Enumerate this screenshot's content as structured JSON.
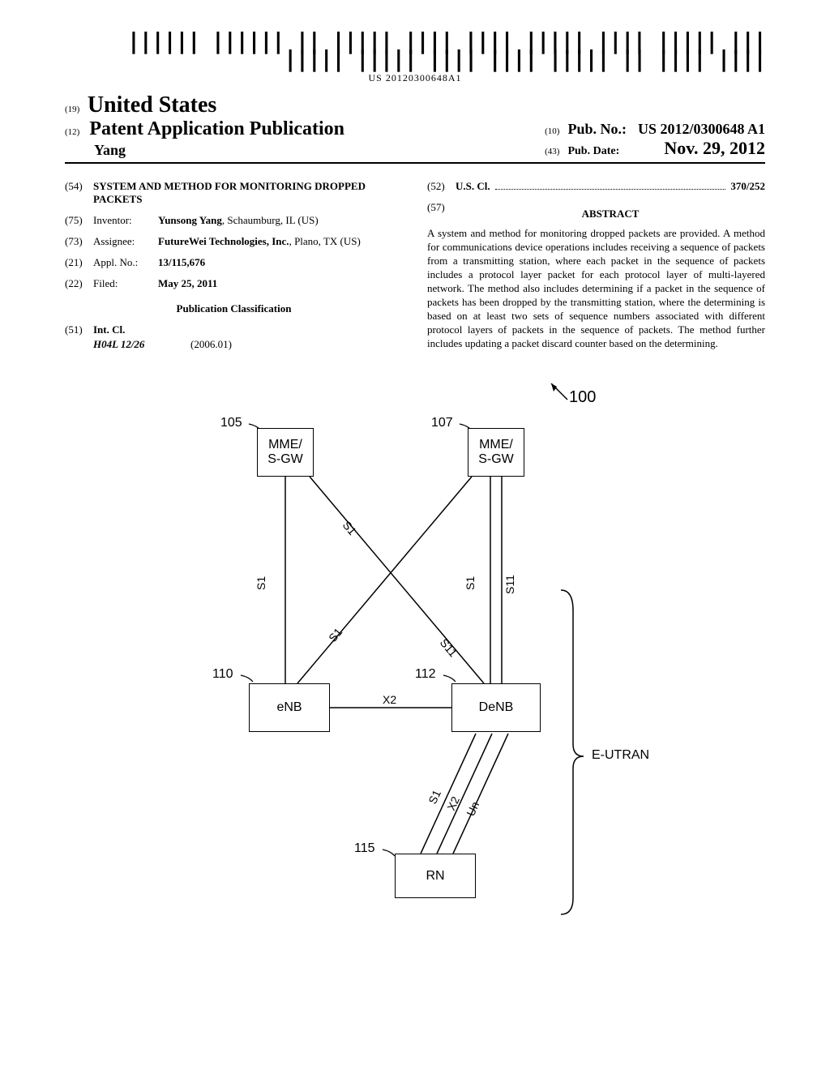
{
  "barcode_number": "US 20120300648A1",
  "header": {
    "country_code": "(19)",
    "country": "United States",
    "pub_type_code": "(12)",
    "pub_type": "Patent Application Publication",
    "inventor_surname": "Yang",
    "pub_no_code": "(10)",
    "pub_no_label": "Pub. No.:",
    "pub_no_value": "US 2012/0300648 A1",
    "pub_date_code": "(43)",
    "pub_date_label": "Pub. Date:",
    "pub_date_value": "Nov. 29, 2012"
  },
  "biblio": {
    "title_code": "(54)",
    "title": "SYSTEM AND METHOD FOR MONITORING DROPPED PACKETS",
    "inventor_code": "(75)",
    "inventor_label": "Inventor:",
    "inventor_value": "Yunsong Yang",
    "inventor_location": ", Schaumburg, IL (US)",
    "assignee_code": "(73)",
    "assignee_label": "Assignee:",
    "assignee_value": "FutureWei Technologies, Inc.",
    "assignee_location": ", Plano, TX (US)",
    "appl_no_code": "(21)",
    "appl_no_label": "Appl. No.:",
    "appl_no_value": "13/115,676",
    "filed_code": "(22)",
    "filed_label": "Filed:",
    "filed_value": "May 25, 2011",
    "pub_class_header": "Publication Classification",
    "int_cl_code": "(51)",
    "int_cl_label": "Int. Cl.",
    "int_cl_value": "H04L 12/26",
    "int_cl_date": "(2006.01)",
    "us_cl_code": "(52)",
    "us_cl_label": "U.S. Cl.",
    "us_cl_value": "370/252",
    "abstract_code": "(57)",
    "abstract_label": "ABSTRACT",
    "abstract_text": "A system and method for monitoring dropped packets are provided. A method for communications device operations includes receiving a sequence of packets from a transmitting station, where each packet in the sequence of packets includes a protocol layer packet for each protocol layer of multi-layered network. The method also includes determining if a packet in the sequence of packets has been dropped by the transmitting station, where the determining is based on at least two sets of sequence numbers associated with different protocol layers of packets in the sequence of packets. The method further includes updating a packet discard counter based on the determining."
  },
  "figure": {
    "ref_100": "100",
    "ref_105": "105",
    "ref_107": "107",
    "ref_110": "110",
    "ref_112": "112",
    "ref_115": "115",
    "box_mme_1": "MME/\nS-GW",
    "box_mme_2": "MME/\nS-GW",
    "box_enb": "eNB",
    "box_denb": "DeNB",
    "box_rn": "RN",
    "link_s1": "S1",
    "link_s11": "S11",
    "link_x2": "X2",
    "link_un": "Un",
    "label_eutran": "E-UTRAN"
  }
}
